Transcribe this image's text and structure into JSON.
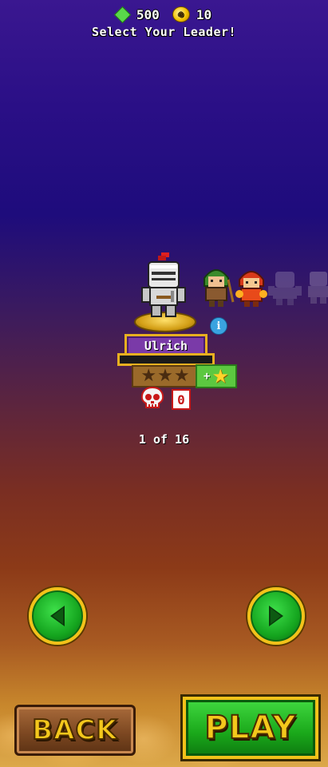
{
  "currency": {
    "gems": "500",
    "coins": "10"
  },
  "title": "Select Your Leader!",
  "leader": {
    "name": "Ulrich",
    "stars_earned": 0,
    "stars_total": 3,
    "kills": "0"
  },
  "pagination": {
    "text": "1 of 16"
  },
  "buttons": {
    "back": "BACK",
    "play": "PLAY"
  },
  "colors": {
    "accent_gold": "#f2c21a",
    "button_green": "#1aa81a",
    "plate_purple": "#7a3aa8"
  }
}
